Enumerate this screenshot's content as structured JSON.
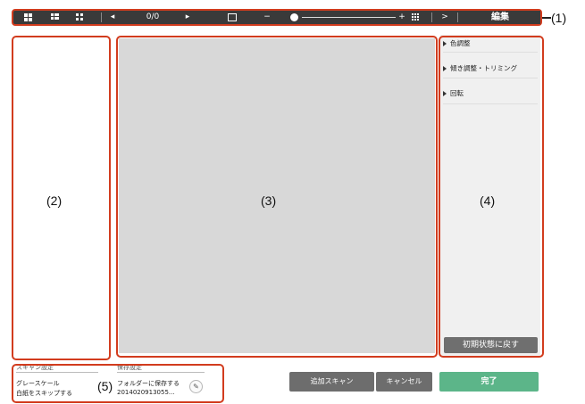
{
  "toolbar": {
    "page_counter": "0/0",
    "prev_symbol": "◂",
    "next_symbol": "▸",
    "zoom_out_symbol": "−",
    "zoom_in_symbol": "+",
    "expand_symbol": ">",
    "edit_label": "編集"
  },
  "callouts": {
    "toolbar": "(1)",
    "thumbnails": "(2)",
    "preview": "(3)",
    "edit_panel": "(4)",
    "settings": "(5)"
  },
  "edit_panel": {
    "items": [
      {
        "label": "色調整"
      },
      {
        "label": "傾き調整・トリミング"
      },
      {
        "label": "回転"
      }
    ],
    "reset_label": "初期状態に戻す"
  },
  "settings": {
    "header_left": "スキャン設定",
    "header_right": "保存設定",
    "color_mode": "グレースケール",
    "skip_blank": "白紙をスキップする",
    "save_folder": "フォルダーに保存する",
    "file_name": "2014020913055..."
  },
  "buttons": {
    "add_scan": "追加スキャン",
    "cancel": "キャンセル",
    "done": "完了"
  },
  "colors": {
    "callout_outline": "#d23c1e",
    "toolbar_bg": "#3a3a3a",
    "done_button": "#5cb589",
    "secondary_button": "#6d6d6d"
  }
}
